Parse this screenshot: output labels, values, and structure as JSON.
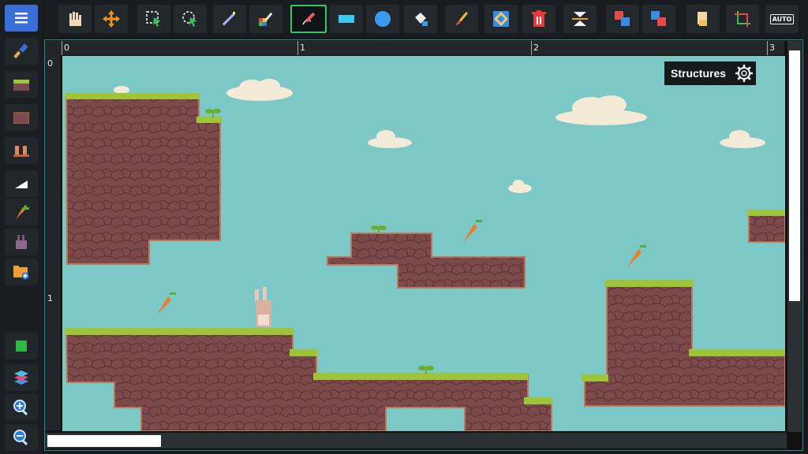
{
  "sidebar": {
    "items": [
      {
        "name": "menu",
        "icon": "menu-icon"
      },
      {
        "name": "brush",
        "icon": "brush-icon"
      },
      {
        "name": "grass-tile",
        "icon": "grass-tile-icon"
      },
      {
        "name": "dirt-tile",
        "icon": "dirt-tile-icon"
      },
      {
        "name": "pillars",
        "icon": "pillars-icon"
      },
      {
        "name": "slope",
        "icon": "slope-icon"
      },
      {
        "name": "carrot",
        "icon": "carrot-icon"
      },
      {
        "name": "bunny",
        "icon": "bunny-icon"
      },
      {
        "name": "folder-add",
        "icon": "folder-add-icon"
      },
      {
        "name": "green-square",
        "icon": "green-square-icon"
      },
      {
        "name": "layers",
        "icon": "layers-icon"
      },
      {
        "name": "zoom-in",
        "icon": "zoom-in-icon"
      },
      {
        "name": "zoom-out",
        "icon": "zoom-out-icon"
      }
    ]
  },
  "toolbar": {
    "tools": [
      {
        "name": "hand",
        "icon": "hand-icon"
      },
      {
        "name": "move",
        "icon": "move-arrows-icon"
      },
      {
        "name": "select-rect",
        "icon": "rect-select-icon"
      },
      {
        "name": "select-lasso",
        "icon": "lasso-select-icon"
      },
      {
        "name": "magic-wand",
        "icon": "magic-wand-icon"
      },
      {
        "name": "color-picker",
        "icon": "color-picker-icon"
      },
      {
        "name": "pencil",
        "icon": "pencil-icon",
        "active": true
      },
      {
        "name": "rectangle",
        "icon": "rectangle-icon"
      },
      {
        "name": "circle",
        "icon": "circle-icon"
      },
      {
        "name": "fill",
        "icon": "paint-bucket-icon"
      },
      {
        "name": "brush",
        "icon": "paintbrush-icon"
      },
      {
        "name": "random-tiles",
        "icon": "random-tiles-icon"
      },
      {
        "name": "delete",
        "icon": "trash-icon"
      },
      {
        "name": "flip",
        "icon": "flip-vertical-icon"
      },
      {
        "name": "copy-layer",
        "icon": "copy-layer-icon"
      },
      {
        "name": "paste-layer",
        "icon": "paste-layer-icon"
      },
      {
        "name": "stamp",
        "icon": "stamp-icon"
      },
      {
        "name": "crop",
        "icon": "crop-icon"
      },
      {
        "name": "auto",
        "icon": "auto-icon",
        "label": "AUTO"
      }
    ]
  },
  "ruler": {
    "top_labels": [
      "0",
      "1",
      "2",
      "3"
    ],
    "left_labels": [
      "0",
      "1"
    ]
  },
  "structures_panel": {
    "title": "Structures"
  },
  "colors": {
    "sky": "#7cc8c6",
    "dirt": "#7d4a4c",
    "grass": "#9ec43a",
    "accent": "#35c86a"
  }
}
